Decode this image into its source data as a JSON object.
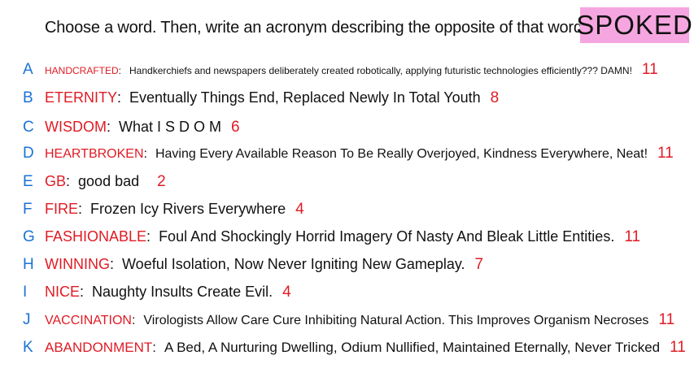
{
  "prompt": "Choose a word. Then, write an acronym describing the opposite of that word!",
  "brand": "SPOKED",
  "colors": {
    "letter": "#1a73d6",
    "word": "#e01b24",
    "count": "#e01b24",
    "brand_bg": "#f5a6e0"
  },
  "rows": [
    {
      "letter": "A",
      "word": "HANDCRAFTED",
      "phrase": "Handkerchiefs and newspapers deliberately created robotically, applying futuristic technologies efficiently??? DAMN!",
      "count": "11"
    },
    {
      "letter": "B",
      "word": "ETERNITY",
      "phrase": "Eventually Things End, Replaced Newly In Total Youth",
      "count": "8"
    },
    {
      "letter": "C",
      "word": "WISDOM",
      "phrase": "What I S D O M",
      "count": "6"
    },
    {
      "letter": "D",
      "word": "HEARTBROKEN",
      "phrase": "Having Every Available Reason To Be Really Overjoyed, Kindness Everywhere, Neat!",
      "count": "11"
    },
    {
      "letter": "E",
      "word": "GB",
      "phrase": "good bad",
      "count": "2"
    },
    {
      "letter": "F",
      "word": "FIRE",
      "phrase": "Frozen Icy Rivers Everywhere",
      "count": "4"
    },
    {
      "letter": "G",
      "word": "FASHIONABLE",
      "phrase": "Foul And Shockingly Horrid Imagery Of Nasty And Bleak Little Entities.",
      "count": "11"
    },
    {
      "letter": "H",
      "word": "WINNING",
      "phrase": "Woeful Isolation, Now Never Igniting New Gameplay.",
      "count": "7"
    },
    {
      "letter": "I",
      "word": "NICE",
      "phrase": "Naughty Insults Create Evil.",
      "count": "4"
    },
    {
      "letter": "J",
      "word": "VACCINATION",
      "phrase": "Virologists Allow Care Cure Inhibiting Natural Action. This Improves Organism Necroses",
      "count": "11"
    },
    {
      "letter": "K",
      "word": "ABANDONMENT",
      "phrase": "A Bed, A Nurturing Dwelling, Odium Nullified, Maintained Eternally, Never Tricked",
      "count": "11"
    }
  ]
}
